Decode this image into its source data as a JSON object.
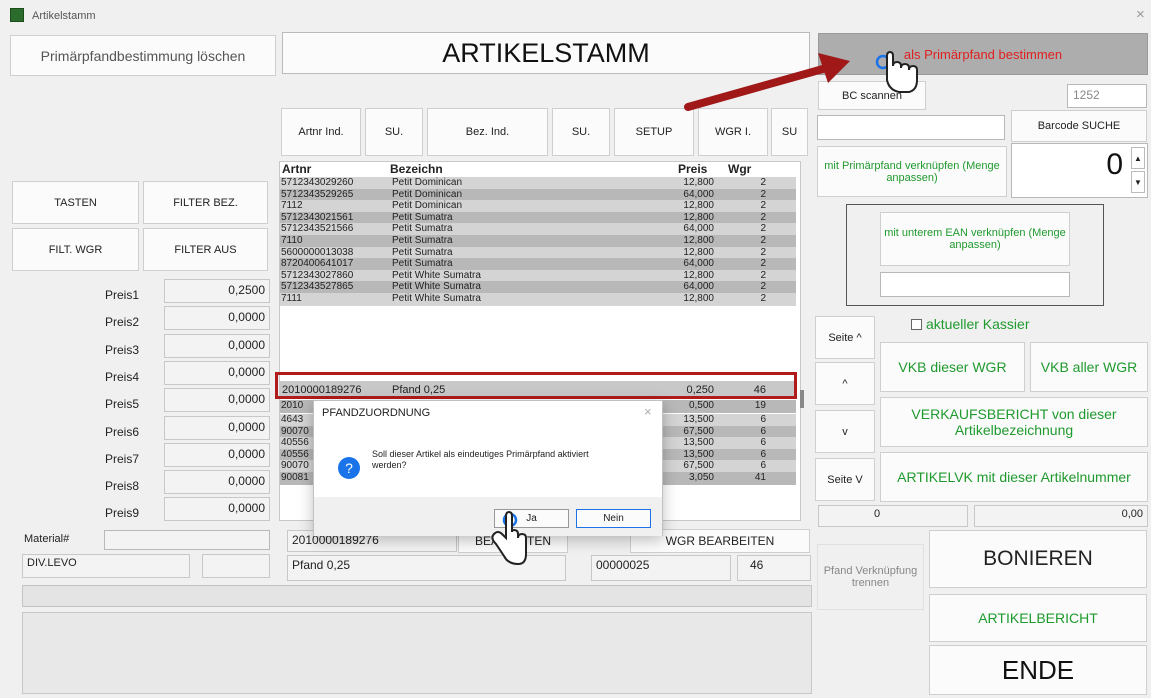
{
  "window": {
    "title": "Artikelstamm"
  },
  "header": {
    "title": "ARTIKELSTAMM"
  },
  "buttons": {
    "primaer_loeschen": "Primärpfandbestimmung löschen",
    "als_primaer": "als Primärpfand bestimmen",
    "bc_scannen": "BC scannen",
    "barcode_suche": "Barcode SUCHE",
    "mit_primaer": "mit Primärpfand verknüpfen (Menge anpassen)",
    "mit_ean": "mit unterem EAN verknüpfen (Menge anpassen)",
    "tasten": "TASTEN",
    "filter_bez": "FILTER BEZ.",
    "filt_wgr": "FILT. WGR",
    "filter_aus": "FILTER AUS",
    "artnr_ind": "Artnr Ind.",
    "su1": "SU.",
    "bez_ind": "Bez. Ind.",
    "su2": "SU.",
    "setup": "SETUP",
    "wgr_i": "WGR I.",
    "su3": "SU",
    "seite_up": "Seite ^",
    "up": "^",
    "down": "v",
    "seite_v": "Seite V",
    "vkb_dieser": "VKB dieser WGR",
    "vkb_aller": "VKB aller WGR",
    "verkaufsbericht": "VERKAUFSBERICHT von dieser Artikelbezeichnung",
    "artikelvk": "ARTIKELVK mit dieser Artikelnummer",
    "bearbeiten": "BEARBEITEN",
    "wgr_bearbeiten": "WGR BEARBEITEN",
    "pfand_trennen": "Pfand Verknüpfung trennen",
    "bonieren": "BONIEREN",
    "artikelbericht": "ARTIKELBERICHT",
    "ende": "ENDE"
  },
  "fields": {
    "num_1252": "1252",
    "menge": "0",
    "left_zero": "0",
    "right_total": "0,00",
    "material_label": "Material#",
    "div_levo": "DIV.LEVO",
    "artnr_value": "2010000189276",
    "bez_value": "Pfand 0,25",
    "code_value": "00000025",
    "wgr_value": "46"
  },
  "kassier": {
    "label": "aktueller Kassier"
  },
  "preise": [
    {
      "label": "Preis1",
      "value": "0,2500"
    },
    {
      "label": "Preis2",
      "value": "0,0000"
    },
    {
      "label": "Preis3",
      "value": "0,0000"
    },
    {
      "label": "Preis4",
      "value": "0,0000"
    },
    {
      "label": "Preis5",
      "value": "0,0000"
    },
    {
      "label": "Preis6",
      "value": "0,0000"
    },
    {
      "label": "Preis7",
      "value": "0,0000"
    },
    {
      "label": "Preis8",
      "value": "0,0000"
    },
    {
      "label": "Preis9",
      "value": "0,0000"
    }
  ],
  "grid": {
    "headers": {
      "artnr": "Artnr",
      "bez": "Bezeichn",
      "preis": "Preis",
      "wgr": "Wgr"
    },
    "rows": [
      {
        "artnr": "5712343029260",
        "bez": "Petit Dominican",
        "preis": "12,800",
        "wgr": "2"
      },
      {
        "artnr": "5712343529265",
        "bez": "Petit Dominican",
        "preis": "64,000",
        "wgr": "2"
      },
      {
        "artnr": "7112",
        "bez": "Petit Dominican",
        "preis": "12,800",
        "wgr": "2"
      },
      {
        "artnr": "5712343021561",
        "bez": "Petit Sumatra",
        "preis": "12,800",
        "wgr": "2"
      },
      {
        "artnr": "5712343521566",
        "bez": "Petit Sumatra",
        "preis": "64,000",
        "wgr": "2"
      },
      {
        "artnr": "7110",
        "bez": "Petit Sumatra",
        "preis": "12,800",
        "wgr": "2"
      },
      {
        "artnr": "5600000013038",
        "bez": "Petit Sumatra",
        "preis": "12,800",
        "wgr": "2"
      },
      {
        "artnr": "8720400641017",
        "bez": "Petit Sumatra",
        "preis": "64,000",
        "wgr": "2"
      },
      {
        "artnr": "5712343027860",
        "bez": "Petit White Sumatra",
        "preis": "12,800",
        "wgr": "2"
      },
      {
        "artnr": "5712343527865",
        "bez": "Petit White Sumatra",
        "preis": "64,000",
        "wgr": "2"
      },
      {
        "artnr": "7111",
        "bez": "Petit White Sumatra",
        "preis": "12,800",
        "wgr": "2"
      }
    ],
    "selected": {
      "artnr": "2010000189276",
      "bez": "Pfand 0,25",
      "preis": "0,250",
      "wgr": "46"
    },
    "below": [
      {
        "artnr": "4643",
        "bez": "",
        "preis": "13,500",
        "wgr": "6"
      },
      {
        "artnr": "90070",
        "bez": "",
        "preis": "67,500",
        "wgr": "6"
      },
      {
        "artnr": "40556",
        "bez": "",
        "preis": "13,500",
        "wgr": "6"
      },
      {
        "artnr": "40556",
        "bez": "",
        "preis": "13,500",
        "wgr": "6"
      },
      {
        "artnr": "90070",
        "bez": "",
        "preis": "67,500",
        "wgr": "6"
      },
      {
        "artnr": "90081",
        "bez": "",
        "preis": "3,050",
        "wgr": "41"
      }
    ],
    "partial_top": {
      "artnr": "2010",
      "preis": "0,500",
      "wgr": "19"
    }
  },
  "dialog": {
    "title": "PFANDZUORDNUNG",
    "message": "Soll dieser Artikel als eindeutiges Primärpfand aktiviert werden?",
    "yes": "Ja",
    "no": "Nein"
  },
  "colors": {
    "green_text": "#1f9a2e",
    "red_text": "#e02020",
    "highlight_border": "#b01c1c",
    "arrow": "#a01818",
    "dialog_accent": "#1a73e8"
  }
}
